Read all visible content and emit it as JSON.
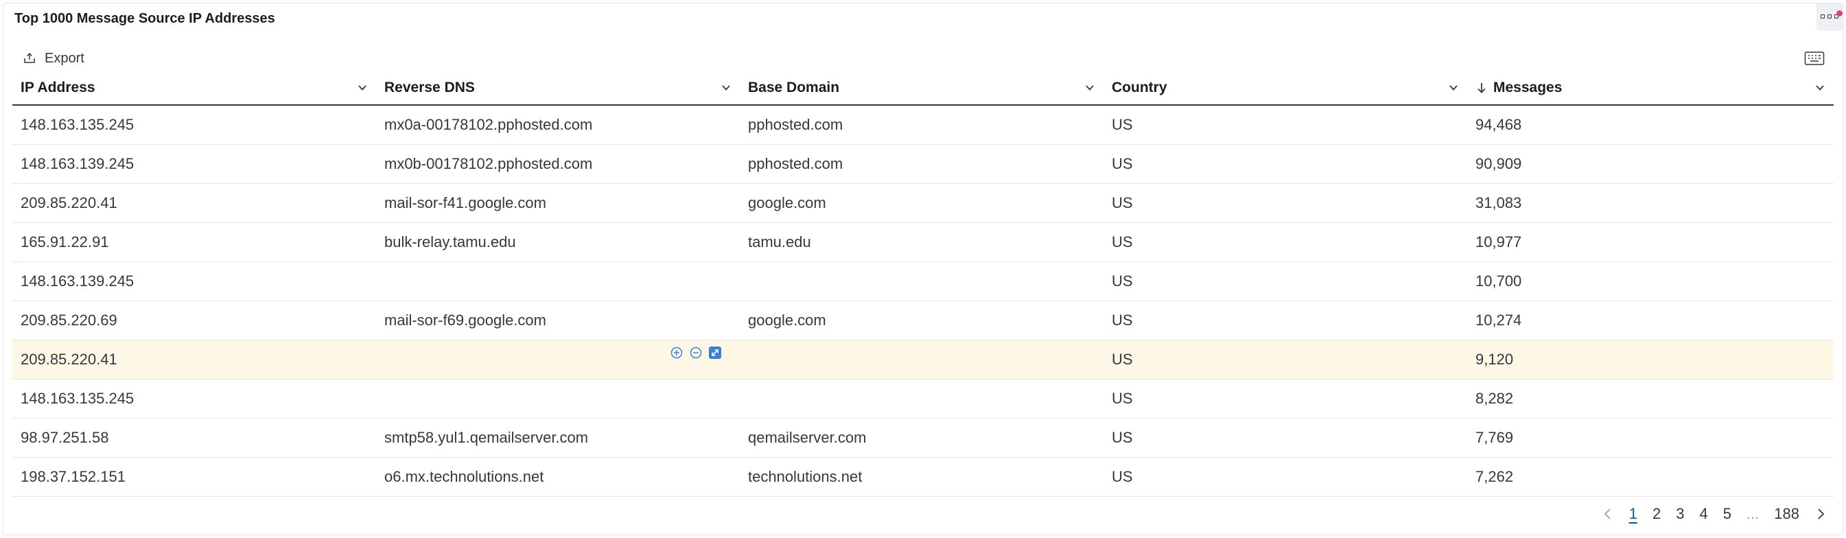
{
  "panel": {
    "title": "Top 1000 Message Source IP Addresses"
  },
  "toolbar": {
    "export_label": "Export"
  },
  "columns": [
    {
      "label": "IP Address"
    },
    {
      "label": "Reverse DNS"
    },
    {
      "label": "Base Domain"
    },
    {
      "label": "Country"
    },
    {
      "label": "Messages",
      "sort": "descending"
    }
  ],
  "rows": [
    {
      "ip": "148.163.135.245",
      "rdns": "mx0a-00178102.pphosted.com",
      "domain": "pphosted.com",
      "country": "US",
      "messages": "94,468"
    },
    {
      "ip": "148.163.139.245",
      "rdns": "mx0b-00178102.pphosted.com",
      "domain": "pphosted.com",
      "country": "US",
      "messages": "90,909"
    },
    {
      "ip": "209.85.220.41",
      "rdns": "mail-sor-f41.google.com",
      "domain": "google.com",
      "country": "US",
      "messages": "31,083"
    },
    {
      "ip": "165.91.22.91",
      "rdns": "bulk-relay.tamu.edu",
      "domain": "tamu.edu",
      "country": "US",
      "messages": "10,977"
    },
    {
      "ip": "148.163.139.245",
      "rdns": "",
      "domain": "",
      "country": "US",
      "messages": "10,700"
    },
    {
      "ip": "209.85.220.69",
      "rdns": "mail-sor-f69.google.com",
      "domain": "google.com",
      "country": "US",
      "messages": "10,274"
    },
    {
      "ip": "209.85.220.41",
      "rdns": "",
      "domain": "",
      "country": "US",
      "messages": "9,120"
    },
    {
      "ip": "148.163.135.245",
      "rdns": "",
      "domain": "",
      "country": "US",
      "messages": "8,282"
    },
    {
      "ip": "98.97.251.58",
      "rdns": "smtp58.yul1.qemailserver.com",
      "domain": "qemailserver.com",
      "country": "US",
      "messages": "7,769"
    },
    {
      "ip": "198.37.152.151",
      "rdns": "o6.mx.technolutions.net",
      "domain": "technolutions.net",
      "country": "US",
      "messages": "7,262"
    }
  ],
  "highlighted_row": 6,
  "pagination": {
    "pages": [
      "1",
      "2",
      "3",
      "4",
      "5"
    ],
    "ellipsis": "...",
    "last": "188",
    "current": "1"
  },
  "colors": {
    "accent": "#0061a6",
    "highlight_row": "#fdf8e5",
    "notification": "#e7407a",
    "action_button": "#3b7fd9"
  },
  "icons": {
    "export": "export-icon",
    "keyboard": "keyboard-icon",
    "menu": "panel-menu-icon",
    "sort": "arrow-down-icon",
    "column_menu": "chevron-down-icon",
    "filter_for": "filter-for-icon",
    "filter_out": "filter-out-icon",
    "expand": "expand-icon",
    "prev": "chevron-left-icon",
    "next": "chevron-right-icon"
  }
}
